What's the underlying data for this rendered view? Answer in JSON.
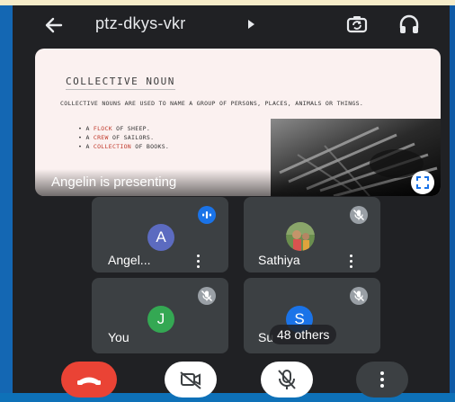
{
  "meeting": {
    "code": "ptz-dkys-vkr"
  },
  "slide": {
    "title": "COLLECTIVE NOUN",
    "body": "COLLECTIVE NOUNS ARE USED TO NAME A GROUP OF PERSONS, PLACES, ANIMALS OR THINGS.",
    "bullets": [
      {
        "pre": "A ",
        "em": "FLOCK",
        "post": " OF SHEEP."
      },
      {
        "pre": "A ",
        "em": "CREW",
        "post": " OF SAILORS."
      },
      {
        "pre": "A ",
        "em": "COLLECTION",
        "post": " OF BOOKS."
      }
    ]
  },
  "presenting_label": "Angelin is presenting",
  "participants": [
    {
      "initial": "A",
      "name": "Angel...",
      "avatar_color": "#5c6bc0",
      "status": "speaking"
    },
    {
      "initial": "",
      "name": "Sathiya",
      "avatar_color": "#7a8a4a",
      "status": "muted"
    },
    {
      "initial": "J",
      "name": "You",
      "avatar_color": "#34a853",
      "status": "muted"
    },
    {
      "initial": "S",
      "name": "Su",
      "avatar_color": "#1a73e8",
      "status": "muted"
    }
  ],
  "others_label": "48 others",
  "colors": {
    "end_call": "#ea4335",
    "speaking": "#1a73e8",
    "muted_badge": "#9aa0a6"
  },
  "icons": [
    "back-arrow-icon",
    "caret-right-icon",
    "switch-camera-icon",
    "headphones-icon",
    "fullscreen-icon",
    "audio-wave-icon",
    "mic-off-icon",
    "phone-hangup-icon",
    "camera-off-icon",
    "more-vertical-icon"
  ]
}
